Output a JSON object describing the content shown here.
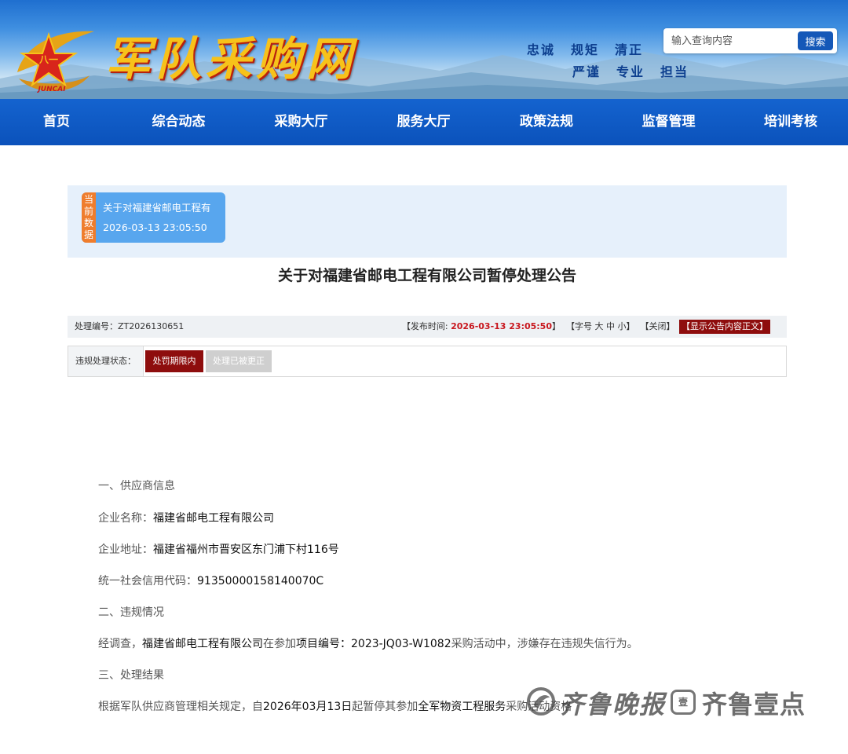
{
  "header": {
    "site_title": "军队采购网",
    "logo_emblem_text": "八一",
    "logo_emblem_subtext": "JUNCAI",
    "motto_line1": [
      "忠诚",
      "规矩",
      "清正"
    ],
    "motto_line2": [
      "严谨",
      "专业",
      "担当"
    ],
    "search_placeholder": "输入查询内容",
    "search_button": "搜索"
  },
  "nav": {
    "items": [
      "首页",
      "综合动态",
      "采购大厅",
      "服务大厅",
      "政策法规",
      "监督管理",
      "培训考核"
    ]
  },
  "current": {
    "tag": "当前数据",
    "title": "关于对福建省邮电工程有",
    "time": "2026-03-13 23:05:50"
  },
  "notice": {
    "title": "关于对福建省邮电工程有限公司暂停处理公告",
    "code_label": "处理编号：",
    "code": "ZT2026130651",
    "publish_prefix": "【发布时间: ",
    "publish_time": "2026-03-13 23:05:50",
    "publish_suffix": "】",
    "font_size_label": "【字号",
    "font_large": "大",
    "font_medium": "中",
    "font_small": "小",
    "font_size_end": "】",
    "close": "【关闭】",
    "show_content": "【显示公告内容正文】",
    "status_label": "违规处理状态：",
    "status_active": "处罚期限内",
    "status_inactive": "处理已被更正"
  },
  "body": {
    "section1": "一、供应商信息",
    "company_label": "企业名称：",
    "company": "福建省邮电工程有限公司",
    "address_label": "企业地址：",
    "address": "福建省福州市晋安区东门浦下村116号",
    "credit_label": "统一社会信用代码：",
    "credit": "91350000158140070C",
    "section2": "二、违规情况",
    "violation_p1": "经调查，",
    "violation_company": "福建省邮电工程有限公司",
    "violation_p2": "在参加",
    "violation_project": "项目编号：2023-JQ03-W1082",
    "violation_p3": "采购活动中，涉嫌存在违规失信行为。",
    "section3": "三、处理结果",
    "result_p1": "根据军队供应商管理相关规定，自",
    "result_date": "2026年03月13日",
    "result_p2": "起暂停其参加",
    "result_scope": "全军物资工程服务",
    "result_p3": "采购活动资格"
  },
  "watermark": {
    "brand1": "齐鲁晚报",
    "badge": "壹",
    "brand2": "齐鲁壹点"
  },
  "colors": {
    "nav_blue": "#0b52bb",
    "accent_red": "#c8161d",
    "status_red": "#8e0d0d",
    "card_blue": "#58a6ee",
    "tag_orange": "#ef7d2d"
  }
}
